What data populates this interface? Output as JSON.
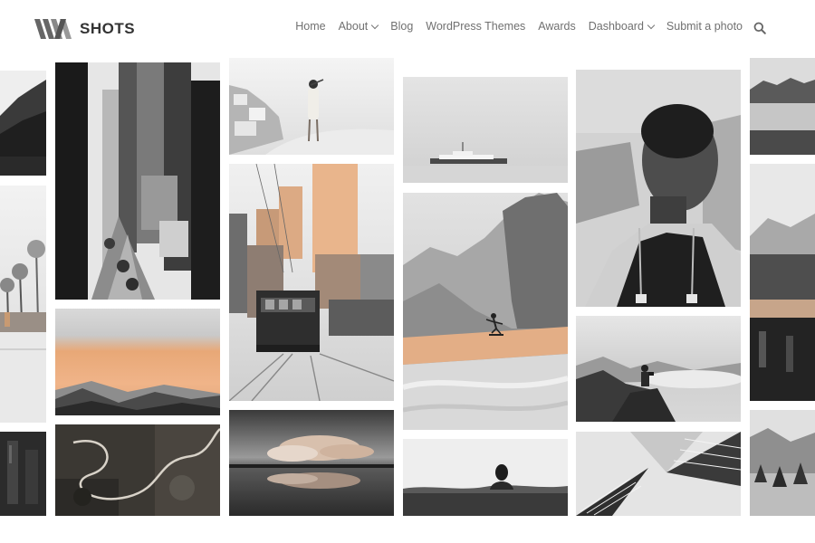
{
  "site": {
    "logo_text": "SHOTS"
  },
  "nav": {
    "items": [
      {
        "label": "Home"
      },
      {
        "label": "About"
      },
      {
        "label": "Blog"
      },
      {
        "label": "WordPress Themes"
      },
      {
        "label": "Awards"
      },
      {
        "label": "Dashboard"
      },
      {
        "label": "Submit a photo"
      }
    ],
    "search_icon": "search-icon"
  },
  "colors": {
    "accent_peach": "#e8a877",
    "text_nav": "#707070",
    "logo_text": "#333333"
  },
  "gallery": {
    "tiles": [
      {
        "name": "photo-mountain-lake-left"
      },
      {
        "name": "photo-palm-trees-beach"
      },
      {
        "name": "photo-building-left-bottom"
      },
      {
        "name": "photo-city-skyscrapers"
      },
      {
        "name": "photo-peach-sky-mountains"
      },
      {
        "name": "photo-winding-road-aerial"
      },
      {
        "name": "photo-woman-on-rooftop"
      },
      {
        "name": "photo-tram-city-street"
      },
      {
        "name": "photo-cloud-reflection-lake"
      },
      {
        "name": "photo-boat-on-sea"
      },
      {
        "name": "photo-skateboarder-cliff"
      },
      {
        "name": "photo-swimmer-in-water"
      },
      {
        "name": "photo-woman-portrait"
      },
      {
        "name": "photo-photographer-mountain"
      },
      {
        "name": "photo-building-facade-abstract"
      },
      {
        "name": "photo-mountain-lake-right"
      },
      {
        "name": "photo-forest-river-right"
      },
      {
        "name": "photo-snowy-trees-right"
      }
    ]
  }
}
